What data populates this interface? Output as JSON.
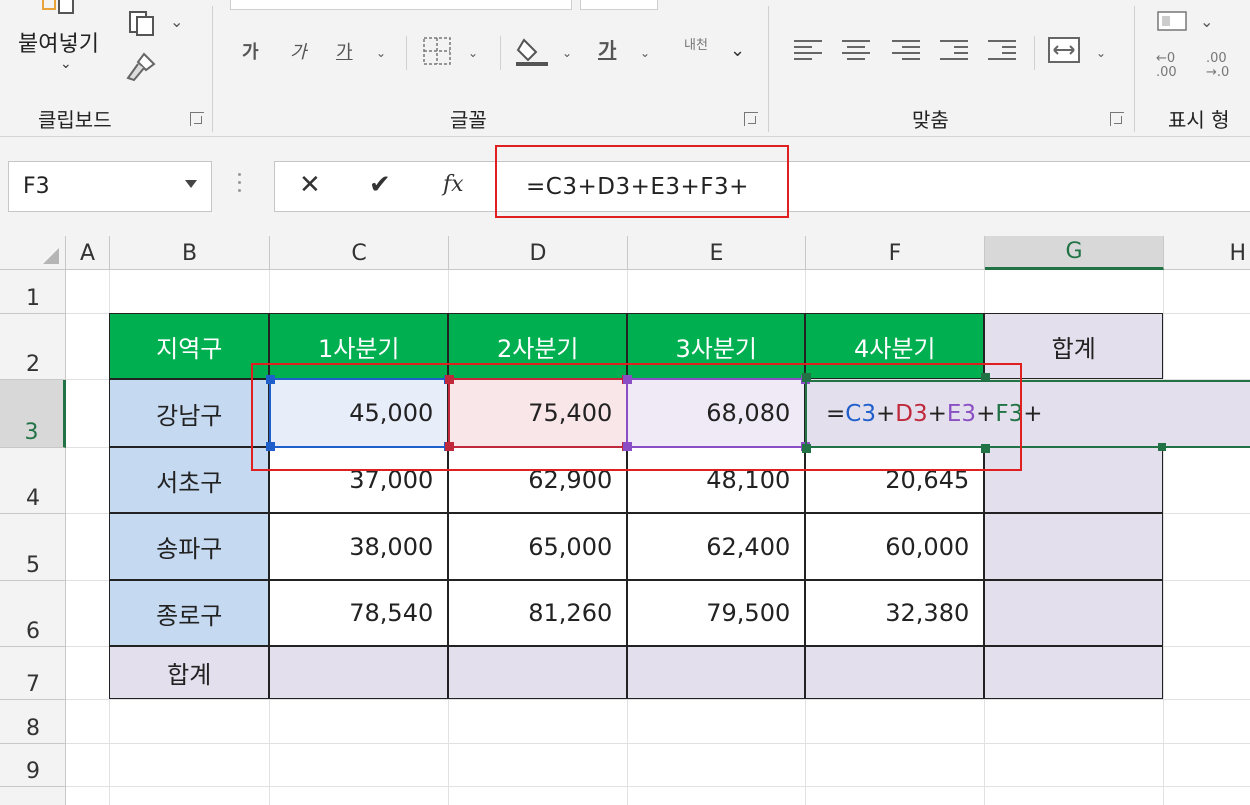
{
  "ribbon": {
    "clipboard": {
      "paste_label": "붙여넣기",
      "group_label": "클립보드"
    },
    "font": {
      "bold_label": "가",
      "italic_label": "가",
      "underline_label": "가",
      "fill_label": "가",
      "wrap_label": "내천",
      "group_label": "글꼴"
    },
    "alignment": {
      "group_label": "맞춤"
    },
    "number": {
      "group_label": "표시 형"
    }
  },
  "formula_bar": {
    "name_box": "F3",
    "formula": "=C3+D3+E3+F3+"
  },
  "grid": {
    "columns": [
      "A",
      "B",
      "C",
      "D",
      "E",
      "F",
      "G",
      "H"
    ],
    "rows": [
      "1",
      "2",
      "3",
      "4",
      "5",
      "6",
      "7",
      "8",
      "9"
    ],
    "active_column": "G",
    "active_row": "3"
  },
  "table": {
    "headers": [
      "지역구",
      "1사분기",
      "2사분기",
      "3사분기",
      "4사분기",
      "합계"
    ],
    "rows": [
      {
        "region": "강남구",
        "q1": "45,000",
        "q2": "75,400",
        "q3": "68,080"
      },
      {
        "region": "서초구",
        "q1": "37,000",
        "q2": "62,900",
        "q3": "48,100",
        "q4": "20,645"
      },
      {
        "region": "송파구",
        "q1": "38,000",
        "q2": "65,000",
        "q3": "62,400",
        "q4": "60,000"
      },
      {
        "region": "종로구",
        "q1": "78,540",
        "q2": "81,260",
        "q3": "79,500",
        "q4": "32,380"
      }
    ],
    "total_label": "합계"
  },
  "edit_formula": {
    "eq": "=",
    "c3": "C3",
    "plus1": "+",
    "d3": "D3",
    "plus2": "+",
    "e3": "E3",
    "plus3": "+",
    "f3": "F3",
    "plus4": "+"
  },
  "colors": {
    "header_green": "#00b050",
    "region_blue": "#c5d9f1",
    "sum_lavender": "#e4dfec",
    "ref_c3": "#1f5fcc",
    "ref_d3": "#c0283c",
    "ref_e3": "#8a4fc4",
    "ref_f3": "#217346",
    "callout_red": "#e02020"
  }
}
